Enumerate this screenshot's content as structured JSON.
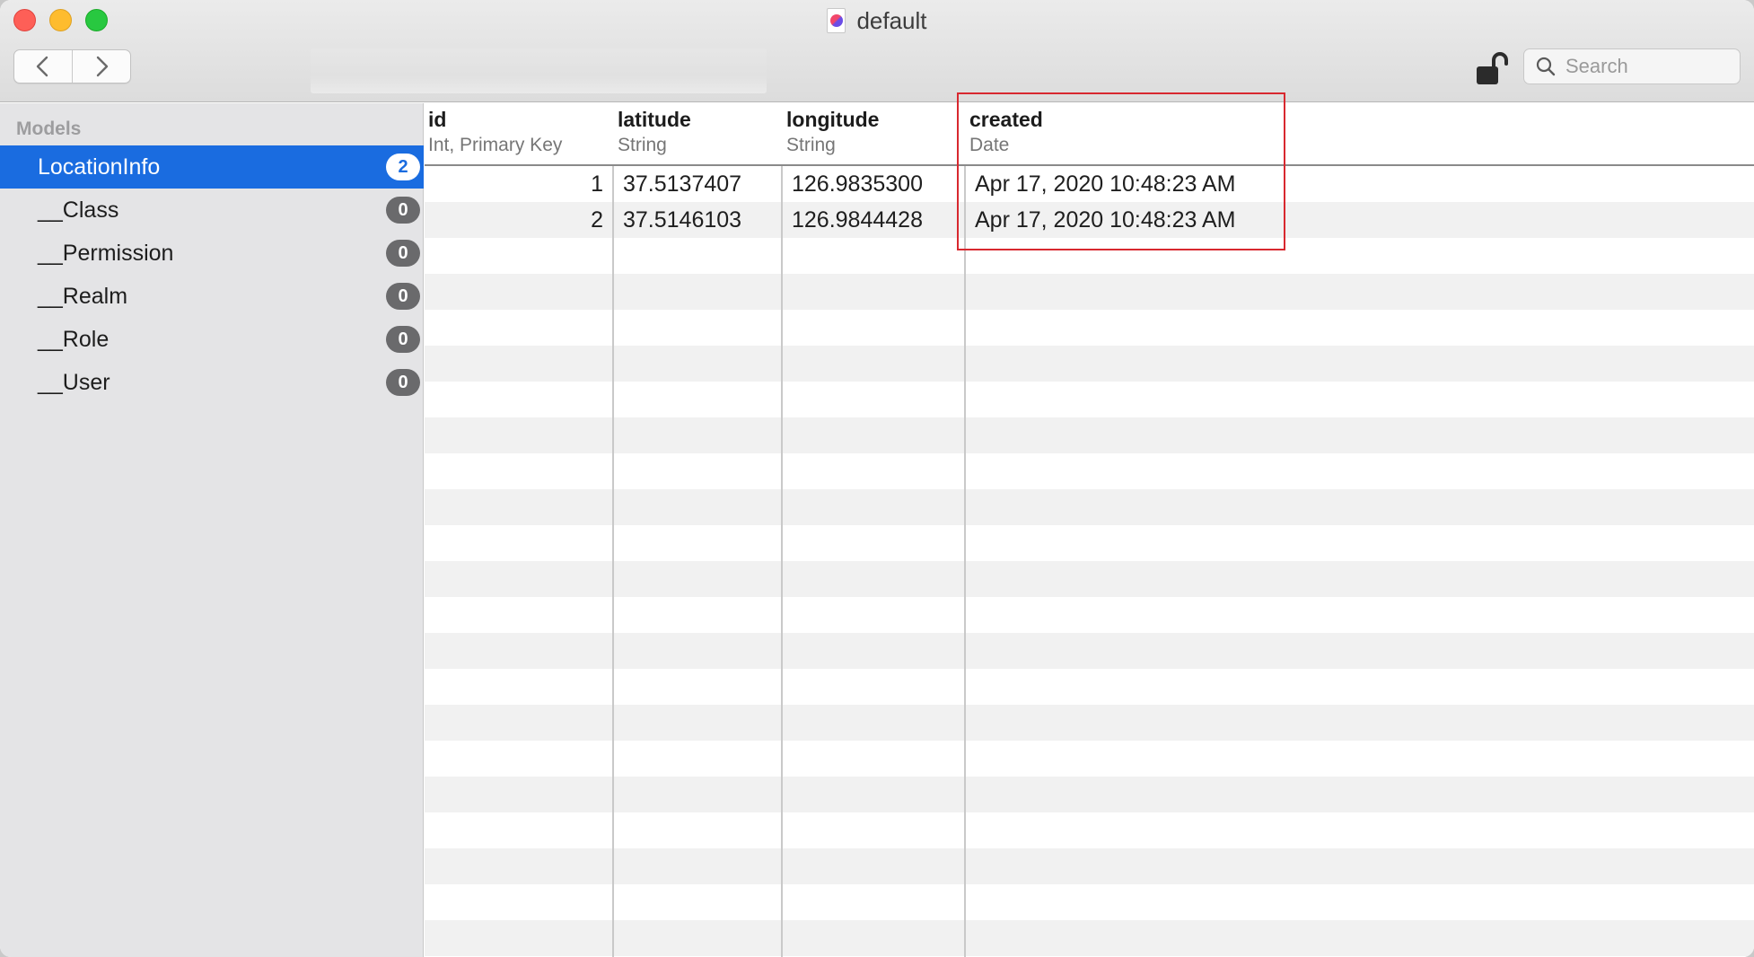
{
  "window": {
    "title": "default"
  },
  "toolbar": {
    "search_placeholder": "Search"
  },
  "sidebar": {
    "heading": "Models",
    "items": [
      {
        "label": "LocationInfo",
        "count": "2",
        "selected": true
      },
      {
        "label": "__Class",
        "count": "0"
      },
      {
        "label": "__Permission",
        "count": "0"
      },
      {
        "label": "__Realm",
        "count": "0"
      },
      {
        "label": "__Role",
        "count": "0"
      },
      {
        "label": "__User",
        "count": "0"
      }
    ]
  },
  "table": {
    "columns": [
      {
        "name": "id",
        "type": "Int, Primary Key"
      },
      {
        "name": "latitude",
        "type": "String"
      },
      {
        "name": "longitude",
        "type": "String"
      },
      {
        "name": "created",
        "type": "Date"
      }
    ],
    "rows": [
      [
        "1",
        "37.5137407",
        "126.9835300",
        "Apr 17, 2020 10:48:23 AM"
      ],
      [
        "2",
        "37.5146103",
        "126.9844428",
        "Apr 17, 2020 10:48:23 AM"
      ]
    ]
  },
  "colors": {
    "selection": "#1a6ce0",
    "highlight_border": "#d8282f",
    "badge": "#6a6a6c"
  }
}
